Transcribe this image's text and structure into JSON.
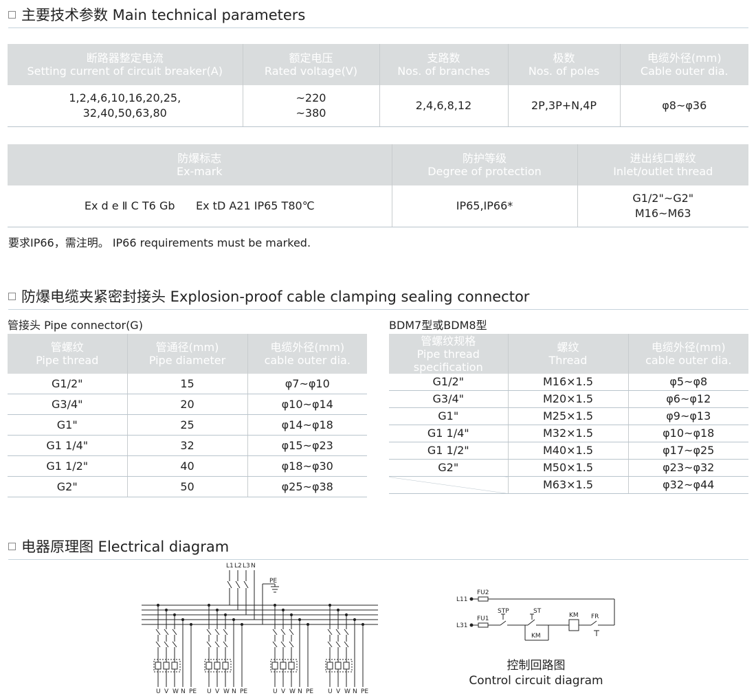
{
  "sections": {
    "main_params": "主要技术参数 Main technical parameters",
    "connector": "防爆电缆夹紧密封接头 Explosion-proof cable clamping sealing connector",
    "electrical": "电器原理图 Electrical diagram"
  },
  "table1": {
    "headers": [
      {
        "cn": "断路器整定电流",
        "en": "Setting current of circuit breaker(A)"
      },
      {
        "cn": "额定电压",
        "en": "Rated voltage(V)"
      },
      {
        "cn": "支路数",
        "en": "Nos. of branches"
      },
      {
        "cn": "极数",
        "en": "Nos. of poles"
      },
      {
        "cn": "电缆外径(mm)",
        "en": "Cable outer dia."
      }
    ],
    "row": {
      "current_1": "1,2,4,6,10,16,20,25,",
      "current_2": "32,40,50,63,80",
      "voltage_1": "~220",
      "voltage_2": "~380",
      "branches": "2,4,6,8,12",
      "poles": "2P,3P+N,4P",
      "cable": "φ8~φ36"
    }
  },
  "table2": {
    "headers": [
      {
        "cn": "防爆标志",
        "en": "Ex-mark"
      },
      {
        "cn": "防护等级",
        "en": "Degree of protection"
      },
      {
        "cn": "进出线口螺纹",
        "en": "Inlet/outlet thread"
      }
    ],
    "row": {
      "exmark": "Ex d e Ⅱ C T6 Gb      Ex tD A21 IP65 T80℃",
      "protection": "IP65,IP66*",
      "thread_1": "G1/2\"~G2\"",
      "thread_2": "M16~M63"
    }
  },
  "note": "要求IP66，需注明。 IP66 requirements must be marked.",
  "pipe_label": "管接头  Pipe connector(G)",
  "bdm_label": "BDM7型或BDM8型",
  "table3": {
    "headers": [
      {
        "cn": "管螺纹",
        "en": "Pipe thread"
      },
      {
        "cn": "管通径(mm)",
        "en": "Pipe diameter"
      },
      {
        "cn": "电缆外径(mm)",
        "en": "cable outer dia."
      }
    ],
    "rows": [
      [
        "G1/2\"",
        "15",
        "φ7~φ10"
      ],
      [
        "G3/4\"",
        "20",
        "φ10~φ14"
      ],
      [
        "G1\"",
        "25",
        "φ14~φ18"
      ],
      [
        "G1 1/4\"",
        "32",
        "φ15~φ23"
      ],
      [
        "G1 1/2\"",
        "40",
        "φ18~φ30"
      ],
      [
        "G2\"",
        "50",
        "φ25~φ38"
      ]
    ]
  },
  "table4": {
    "headers": [
      {
        "cn": "管螺纹规格",
        "en1": "Pipe thread",
        "en2": "specification"
      },
      {
        "cn": "螺纹",
        "en": "Thread"
      },
      {
        "cn": "电缆外径(mm)",
        "en": "cable outer dia."
      }
    ],
    "rows": [
      [
        "G1/2\"",
        "M16×1.5",
        "φ5~φ8"
      ],
      [
        "G3/4\"",
        "M20×1.5",
        "φ6~φ12"
      ],
      [
        "G1\"",
        "M25×1.5",
        "φ9~φ13"
      ],
      [
        "G1 1/4\"",
        "M32×1.5",
        "φ10~φ18"
      ],
      [
        "G1 1/2\"",
        "M40×1.5",
        "φ17~φ25"
      ],
      [
        "G2\"",
        "M50×1.5",
        "φ23~φ32"
      ],
      [
        "",
        "M63×1.5",
        "φ32~φ44"
      ]
    ]
  },
  "diagram": {
    "bus_labels": [
      "L1",
      "L2",
      "L3",
      "N"
    ],
    "pe_label": "PE",
    "out_labels": [
      "U",
      "V",
      "W",
      "N",
      "PE"
    ],
    "ctrl": {
      "l11": "L11",
      "l31": "L31",
      "fu2": "FU2",
      "fu1": "FU1",
      "stp": "STP",
      "st": "ST",
      "km": "KM",
      "km2": "KM",
      "fr": "FR"
    }
  },
  "caption": {
    "cn": "控制回路图",
    "en": "Control circuit diagram"
  }
}
